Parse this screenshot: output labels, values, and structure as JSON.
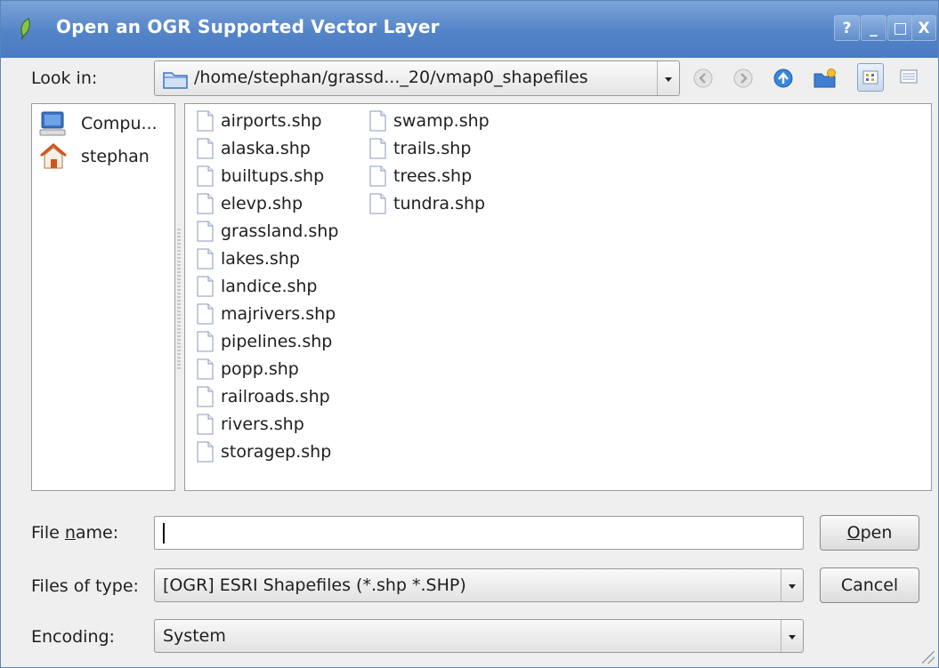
{
  "window": {
    "title": "Open an OGR Supported Vector Layer",
    "controls": {
      "help": "?",
      "minimize": "_",
      "maximize": "□",
      "close": "X"
    }
  },
  "lookin": {
    "label": "Look in:",
    "path": "/home/stephan/grassd..._20/vmap0_shapefiles"
  },
  "sidebar": {
    "items": [
      {
        "label": "Compu...",
        "icon": "computer-icon"
      },
      {
        "label": "stephan",
        "icon": "home-icon"
      }
    ]
  },
  "files": {
    "column1": [
      "airports.shp",
      "alaska.shp",
      "builtups.shp",
      "elevp.shp",
      "grassland.shp",
      "lakes.shp",
      "landice.shp",
      "majrivers.shp",
      "pipelines.shp",
      "popp.shp",
      "railroads.shp",
      "rivers.shp",
      "storagep.shp"
    ],
    "column2": [
      "swamp.shp",
      "trails.shp",
      "trees.shp",
      "tundra.shp"
    ]
  },
  "filename": {
    "label_pre": "File ",
    "label_u": "n",
    "label_post": "ame:",
    "value": ""
  },
  "filetype": {
    "label": "Files of type:",
    "value": "[OGR] ESRI Shapefiles (*.shp *.SHP)"
  },
  "encoding": {
    "label": "Encoding:",
    "value": "System"
  },
  "buttons": {
    "open_u": "O",
    "open_rest": "pen",
    "cancel": "Cancel"
  },
  "colors": {
    "titlebar": "#5384c8",
    "dialog_bg": "#efefef",
    "accent_blue": "#3a73c6"
  }
}
